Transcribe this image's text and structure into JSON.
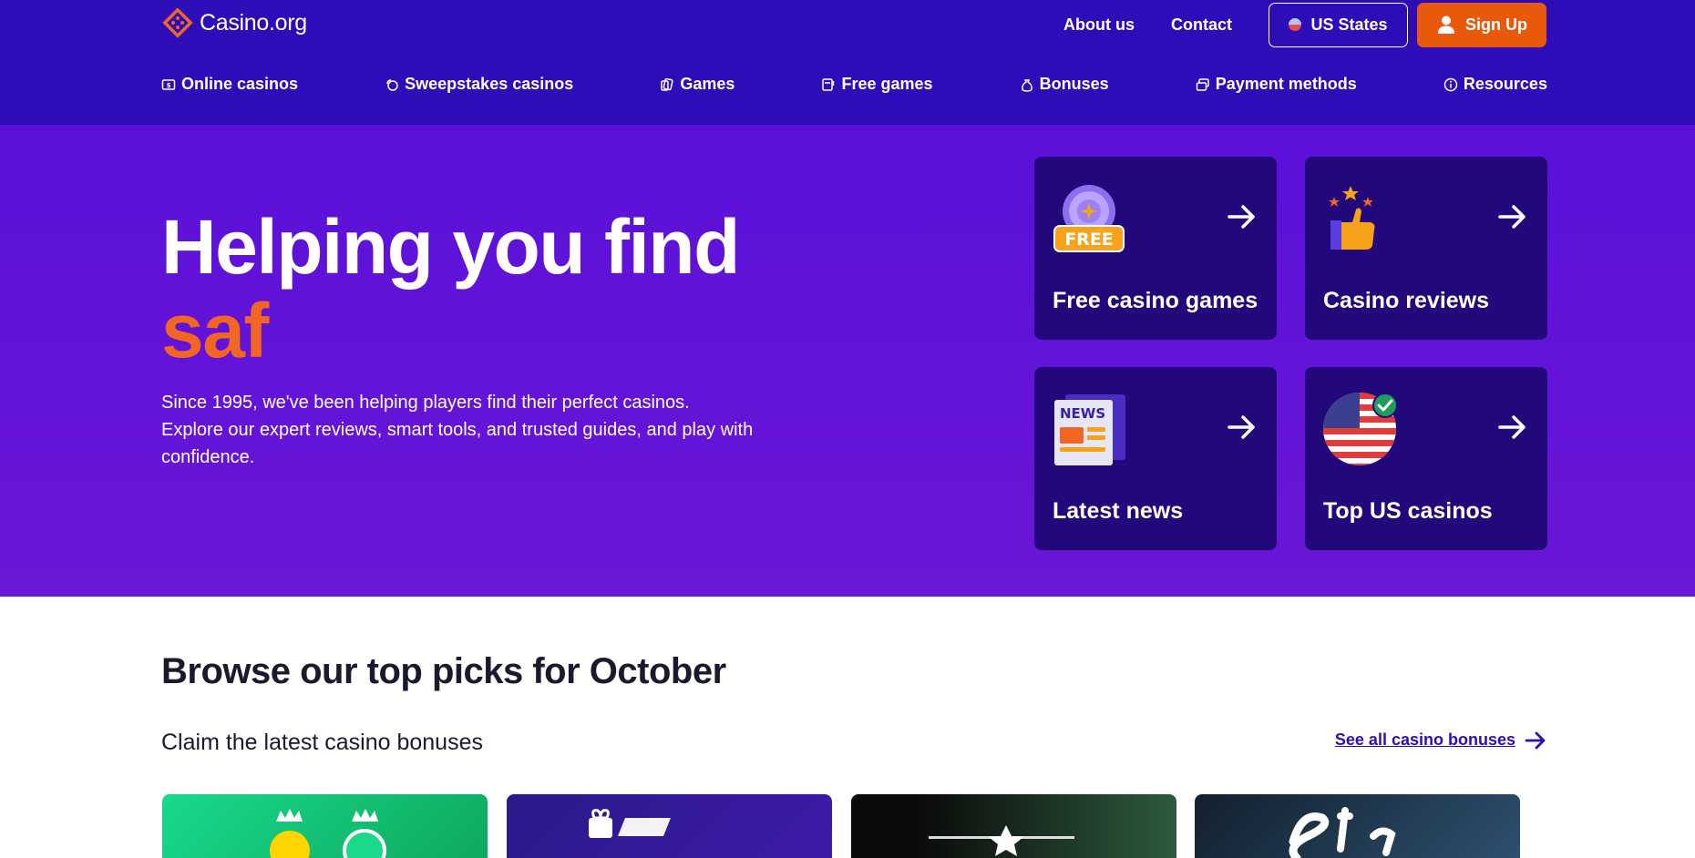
{
  "header": {
    "logo_text": "Casino.org",
    "top_links": [
      "About us",
      "Contact"
    ],
    "us_states_label": "US States",
    "signup_label": "Sign Up"
  },
  "nav": {
    "items": [
      {
        "label": "Online casinos",
        "icon": "casino-icon"
      },
      {
        "label": "Sweepstakes casinos",
        "icon": "coins-icon"
      },
      {
        "label": "Games",
        "icon": "cards-icon"
      },
      {
        "label": "Free games",
        "icon": "slot-icon"
      },
      {
        "label": "Bonuses",
        "icon": "money-bag-icon"
      },
      {
        "label": "Payment methods",
        "icon": "payment-icon"
      },
      {
        "label": "Resources",
        "icon": "info-icon"
      }
    ]
  },
  "hero": {
    "title_line1": "Helping you find",
    "title_accent": "saf",
    "subtitle": "Since 1995, we've been helping players find their perfect casinos. Explore our expert reviews, smart tools, and trusted guides, and play with confidence.",
    "cards": [
      {
        "title": "Free casino games",
        "icon": "free-chip-icon"
      },
      {
        "title": "Casino reviews",
        "icon": "thumbs-up-icon"
      },
      {
        "title": "Latest news",
        "icon": "news-icon",
        "badge": "NEWS"
      },
      {
        "title": "Top US casinos",
        "icon": "us-flag-icon"
      }
    ],
    "free_badge": "FREE"
  },
  "browse": {
    "title": "Browse our top picks for October",
    "subtitle": "Claim the latest casino bonuses",
    "see_all": "See all casino bonuses"
  },
  "colors": {
    "header_bg": "#2d0db8",
    "hero_bg": "#6a17d6",
    "card_bg": "#22087a",
    "accent": "#f26522",
    "signup": "#e8590c"
  }
}
